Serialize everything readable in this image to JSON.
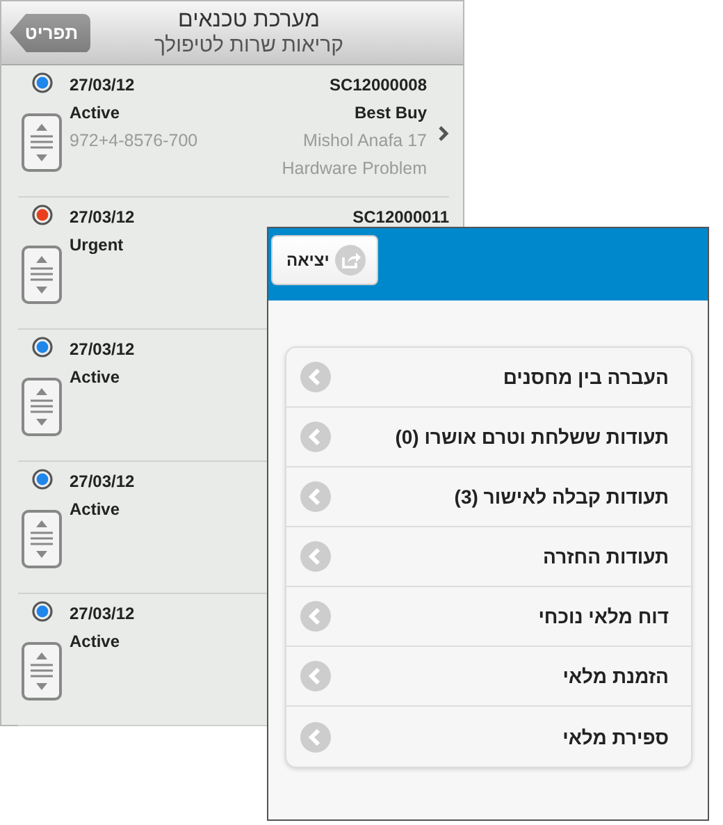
{
  "app": {
    "back_button": "תפריט",
    "title": "מערכת טכנאים",
    "subtitle": "קריאות שרות לטיפולך"
  },
  "calls": [
    {
      "date": "27/03/12",
      "status": "Active",
      "color": "#1f86ea",
      "phone": "972+4-8576-700",
      "id": "SC12000008",
      "customer": "Best Buy",
      "address": "Mishol Anafa 17",
      "problem": "Hardware Problem"
    },
    {
      "date": "27/03/12",
      "status": "Urgent",
      "color": "#e8401c",
      "id": "SC12000011"
    },
    {
      "date": "27/03/12",
      "status": "Active",
      "color": "#1f86ea"
    },
    {
      "date": "27/03/12",
      "status": "Active",
      "color": "#1f86ea"
    },
    {
      "date": "27/03/12",
      "status": "Active",
      "color": "#1f86ea"
    }
  ],
  "menu_window": {
    "exit_button": "יציאה",
    "items": [
      "העברה בין מחסנים",
      "תעודות ששלחת וטרם אושרו (0)",
      "תעודות קבלה לאישור (3)",
      "תעודות החזרה",
      "דוח מלאי נוכחי",
      "הזמנת מלאי",
      "ספירת מלאי"
    ]
  }
}
